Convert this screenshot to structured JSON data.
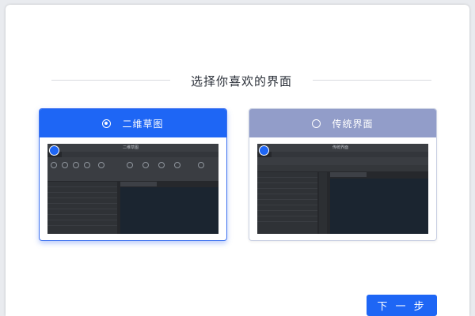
{
  "heading": "选择你喜欢的界面",
  "options": [
    {
      "label": "二维草图",
      "selected": true,
      "preview_title": "二维草图"
    },
    {
      "label": "传统界面",
      "selected": false,
      "preview_title": "传统界面"
    }
  ],
  "next_button": "下 一 步",
  "colors": {
    "accent": "#1e66f5",
    "unselected_header": "#929dc9"
  }
}
